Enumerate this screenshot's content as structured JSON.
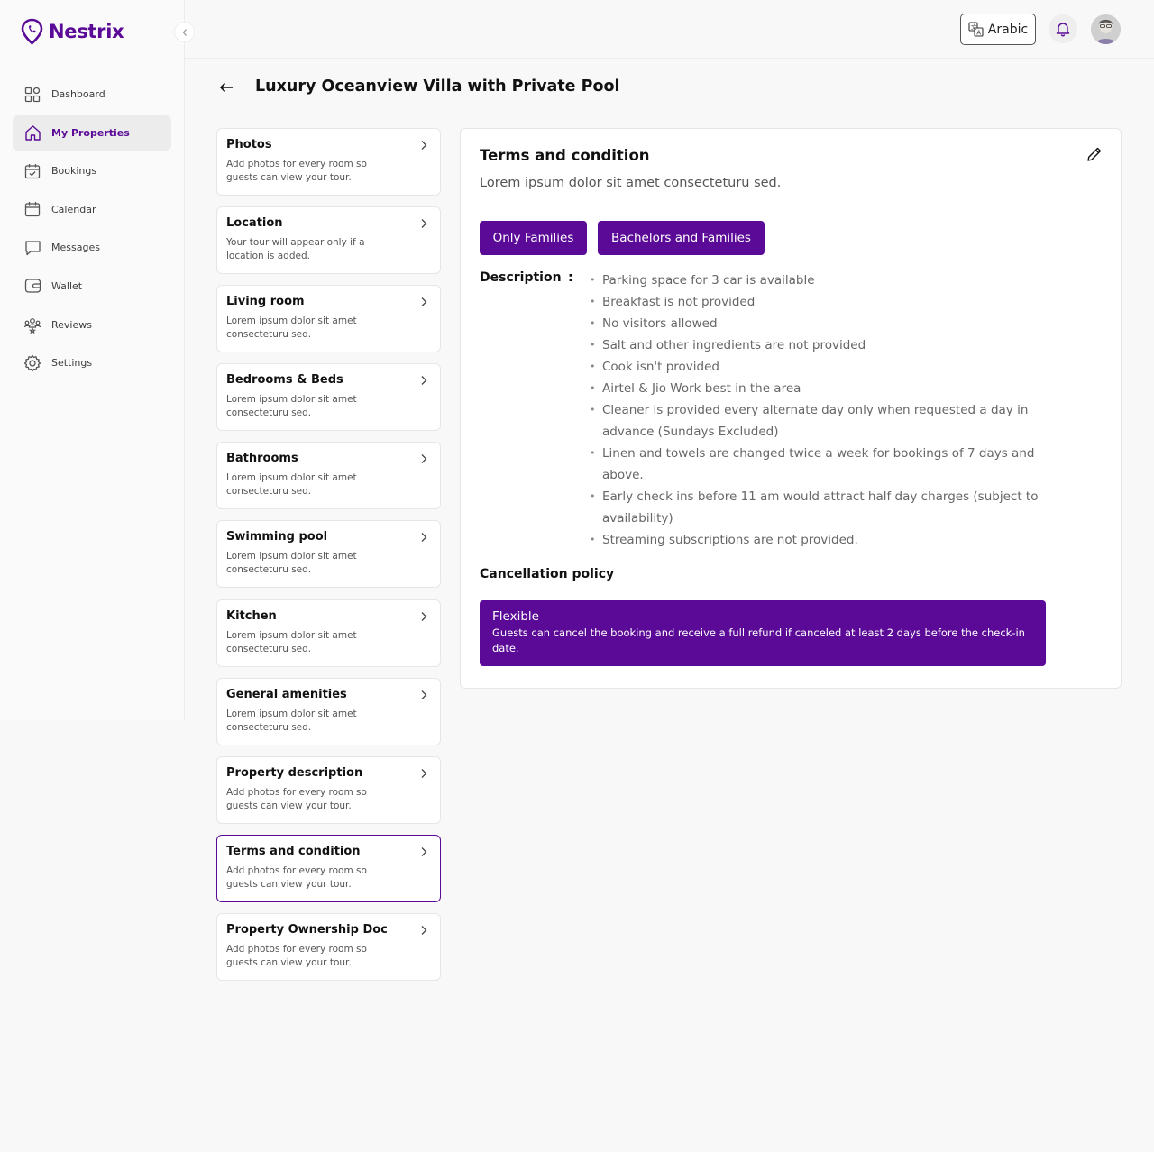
{
  "app": {
    "name": "Nestrix",
    "brand_color": "#5a0a96"
  },
  "sidebar": {
    "items": [
      {
        "label": "Dashboard",
        "icon": "dashboard-icon"
      },
      {
        "label": "My Properties",
        "icon": "home-icon",
        "active": true
      },
      {
        "label": "Bookings",
        "icon": "calendar-check-icon"
      },
      {
        "label": "Calendar",
        "icon": "calendar-icon"
      },
      {
        "label": "Messages",
        "icon": "message-icon"
      },
      {
        "label": "Wallet",
        "icon": "wallet-icon"
      },
      {
        "label": "Reviews",
        "icon": "reviews-icon"
      },
      {
        "label": "Settings",
        "icon": "gear-icon"
      }
    ]
  },
  "topbar": {
    "language": "Arabic"
  },
  "page": {
    "title": "Luxury Oceanview Villa with Private Pool"
  },
  "sections": [
    {
      "title": "Photos",
      "desc": "Add photos for every room so guests can view your tour."
    },
    {
      "title": "Location",
      "desc": "Your tour will appear only if a location is added."
    },
    {
      "title": "Living room",
      "desc": "Lorem ipsum dolor sit amet consecteturu sed."
    },
    {
      "title": "Bedrooms & Beds",
      "desc": "Lorem ipsum dolor sit amet consecteturu sed."
    },
    {
      "title": "Bathrooms",
      "desc": "Lorem ipsum dolor sit amet consecteturu sed."
    },
    {
      "title": "Swimming pool",
      "desc": "Lorem ipsum dolor sit amet consecteturu sed."
    },
    {
      "title": "Kitchen",
      "desc": "Lorem ipsum dolor sit amet consecteturu sed."
    },
    {
      "title": "General amenities",
      "desc": "Lorem ipsum dolor sit amet consecteturu sed."
    },
    {
      "title": "Property description",
      "desc": "Add photos for every room so guests can view your tour."
    },
    {
      "title": "Terms and condition",
      "desc": "Add photos for every room so guests can view your tour.",
      "active": true
    },
    {
      "title": "Property Ownership Doc",
      "desc": "Add photos for every room so guests can view your tour."
    }
  ],
  "detail": {
    "title": "Terms and condition",
    "subtitle": "Lorem ipsum dolor sit amet consecteturu sed.",
    "chips": [
      "Only Families",
      "Bachelors and Families"
    ],
    "description_label": "Description",
    "description_colon": ":",
    "description_items": [
      "Parking space for 3 car is available",
      "Breakfast is not provided",
      "No visitors allowed",
      "Salt and other ingredients are not provided",
      "Cook isn't provided",
      "Airtel & Jio Work best in the area",
      "Cleaner is provided every alternate day only when requested a day in advance (Sundays Excluded)",
      "Linen and towels are changed twice a week for bookings of 7 days and above.",
      "Early check ins before 11 am would attract half day charges (subject to availability)",
      "Streaming subscriptions are not provided."
    ],
    "cancellation_title": "Cancellation policy",
    "policy": {
      "name": "Flexible",
      "text": "Guests can cancel the booking and receive a full refund if canceled at least 2 days before the check-in date."
    }
  }
}
